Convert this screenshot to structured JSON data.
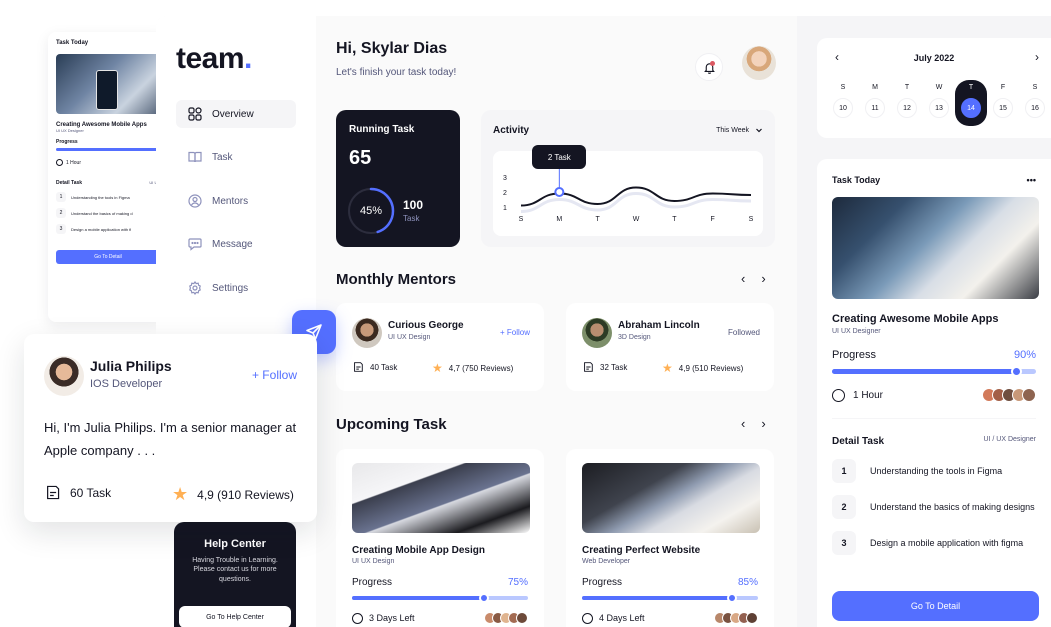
{
  "colors": {
    "accent": "#546FFF",
    "dark": "#141522",
    "muted": "#54577A",
    "star": "#FFB054"
  },
  "mini_card": {
    "title": "Task Today",
    "task_title": "Creating Awesome Mobile Apps",
    "task_role": "UI UX Designer",
    "progress_label": "Progress",
    "time": "1 Hour",
    "detail_label": "Detail Task",
    "detail_role": "UI UX",
    "steps": [
      "Understanding the tools in Figma",
      "Understand the basics of making d",
      "Design a mobile application with fi"
    ],
    "button": "Go To Detail"
  },
  "sidebar": {
    "logo": "team",
    "logo_dot": ".",
    "items": [
      {
        "label": "Overview",
        "icon": "grid-icon",
        "active": true
      },
      {
        "label": "Task",
        "icon": "book-icon"
      },
      {
        "label": "Mentors",
        "icon": "user-icon"
      },
      {
        "label": "Message",
        "icon": "chat-icon"
      },
      {
        "label": "Settings",
        "icon": "gear-icon"
      }
    ],
    "help": {
      "title": "Help Center",
      "desc": "Having Trouble in Learning. Please contact us for more questions.",
      "button": "Go To Help Center"
    }
  },
  "header": {
    "greeting": "Hi, Skylar Dias",
    "subtitle": "Let's finish your task today!"
  },
  "running_task": {
    "title": "Running Task",
    "value": "65",
    "percent_label": "45%",
    "percent": 45,
    "total": "100",
    "unit": "Task"
  },
  "activity": {
    "title": "Activity",
    "range": "This Week",
    "tooltip": "2 Task"
  },
  "chart_data": {
    "type": "line",
    "categories": [
      "S",
      "M",
      "T",
      "W",
      "T",
      "F",
      "S"
    ],
    "yticks": [
      "1",
      "2",
      "3"
    ],
    "ylim": [
      1,
      3
    ],
    "series": [
      {
        "values": [
          1.1,
          1.9,
          1.2,
          2.3,
          1.4,
          1.9,
          1.8
        ]
      }
    ],
    "highlight": {
      "category_index": 1,
      "value": 2,
      "label": "2 Task"
    }
  },
  "monthly_mentors": {
    "title": "Monthly Mentors",
    "items": [
      {
        "name": "Curious George",
        "role": "UI UX Design",
        "follow": "+ Follow",
        "tasks": "40 Task",
        "rating": "4,7 (750 Reviews)"
      },
      {
        "name": "Abraham Lincoln",
        "role": "3D Design",
        "follow": "Followed",
        "tasks": "32 Task",
        "rating": "4,9 (510 Reviews)"
      }
    ]
  },
  "upcoming": {
    "title": "Upcoming Task",
    "items": [
      {
        "title": "Creating Mobile App Design",
        "role": "UI UX Design",
        "progress_label": "Progress",
        "percent_label": "75%",
        "percent": 75,
        "time": "3 Days Left"
      },
      {
        "title": "Creating Perfect Website",
        "role": "Web Developer",
        "progress_label": "Progress",
        "percent_label": "85%",
        "percent": 85,
        "time": "4 Days Left"
      }
    ]
  },
  "calendar": {
    "month": "July 2022",
    "days": [
      {
        "wd": "S",
        "d": "10"
      },
      {
        "wd": "M",
        "d": "11"
      },
      {
        "wd": "T",
        "d": "12"
      },
      {
        "wd": "W",
        "d": "13"
      },
      {
        "wd": "T",
        "d": "14",
        "selected": true
      },
      {
        "wd": "F",
        "d": "15"
      },
      {
        "wd": "S",
        "d": "16"
      }
    ]
  },
  "task_today": {
    "title": "Task Today",
    "more": "•••",
    "task_title": "Creating Awesome Mobile Apps",
    "task_role": "UI UX Designer",
    "progress_label": "Progress",
    "percent_label": "90%",
    "percent": 90,
    "time": "1 Hour",
    "detail_label": "Detail Task",
    "detail_role": "UI / UX Designer",
    "steps": [
      {
        "n": "1",
        "text": "Understanding the tools in Figma"
      },
      {
        "n": "2",
        "text": "Understand the basics of making designs"
      },
      {
        "n": "3",
        "text": "Design a mobile application with figma"
      }
    ],
    "button": "Go To Detail"
  },
  "profile_card": {
    "name": "Julia Philips",
    "role": "IOS Developer",
    "follow": "+ Follow",
    "bio": "Hi, I'm Julia Philips. I'm a senior manager at Apple company . . .",
    "tasks": "60 Task",
    "rating": "4,9 (910 Reviews)"
  }
}
